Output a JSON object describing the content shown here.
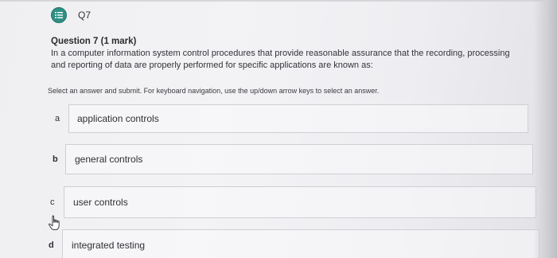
{
  "header": {
    "question_number": "Q7",
    "icon": "list-icon",
    "icon_color": "#2e8f84"
  },
  "question": {
    "title": "Question 7 (1 mark)",
    "text": "In a computer information system control procedures that provide reasonable assurance that the recording, processing and reporting of data are properly performed for specific applications are known as:"
  },
  "instruction": "Select an answer and submit. For keyboard navigation, use the up/down arrow keys to select an answer.",
  "options": [
    {
      "letter": "a",
      "label": "application controls"
    },
    {
      "letter": "b",
      "label": "general controls"
    },
    {
      "letter": "c",
      "label": "user controls"
    },
    {
      "letter": "d",
      "label": "integrated testing"
    }
  ],
  "cursor": "hand-pointer-icon"
}
